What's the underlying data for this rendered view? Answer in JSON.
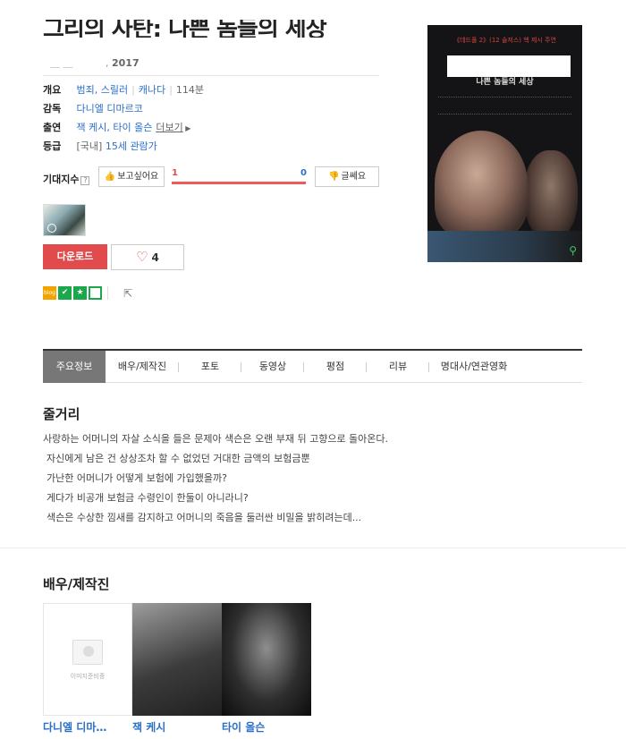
{
  "movie": {
    "title": "그리의 사탄: 나쁜 놈들의 세상",
    "year": "2017",
    "info": {
      "genre_label": "개요",
      "genres": "범죄, 스릴러",
      "country": "캐나다",
      "runtime": "114분",
      "director_label": "감독",
      "director": "다니엘 디마르코",
      "cast_label": "출연",
      "cast": "잭 케시, 타이 올슨",
      "more": "더보기",
      "rating_label": "등급",
      "rating_region": "[국내]",
      "rating": "15세 관람가"
    },
    "expect": {
      "label": "기대지수",
      "want_label": "보고싶어요",
      "nah_label": "글쎄요",
      "want_count": "1",
      "nah_count": "0",
      "want_ratio": 1.0
    },
    "download_label": "다운로드",
    "like_count": "4",
    "poster": {
      "tag": "《데드풀 2》(12 솔저스) 핵 제시 주연",
      "subtitle": "나쁜 놈들의 세상"
    }
  },
  "tabs": [
    {
      "label": "주요정보"
    },
    {
      "label": "배우/제작진"
    },
    {
      "label": "포토"
    },
    {
      "label": "동영상"
    },
    {
      "label": "평점"
    },
    {
      "label": "리뷰"
    },
    {
      "label": "명대사/연관영화"
    }
  ],
  "story": {
    "title": "줄거리",
    "lines": [
      "사랑하는 어머니의 자살 소식을 들은 문제아 색슨은 오랜 부재 뒤 고향으로 돌아온다.",
      "자신에게 남은 건 상상조차 할 수 없었던 거대한 금액의 보험금뿐",
      "가난한 어머니가 어떻게 보험에 가입했을까?",
      "게다가 비공개 보험금 수령인이 한둘이 아니라니?",
      "색슨은 수상한 낌새를 감지하고 어머니의 죽음을 둘러싼 비밀을 밝히려는데..."
    ]
  },
  "cast_section": {
    "title": "배우/제작진",
    "no_image": "이미지준비중",
    "people": [
      {
        "name": "다니엘 디마…"
      },
      {
        "name": "잭 케시"
      },
      {
        "name": "타이 올슨"
      }
    ]
  }
}
